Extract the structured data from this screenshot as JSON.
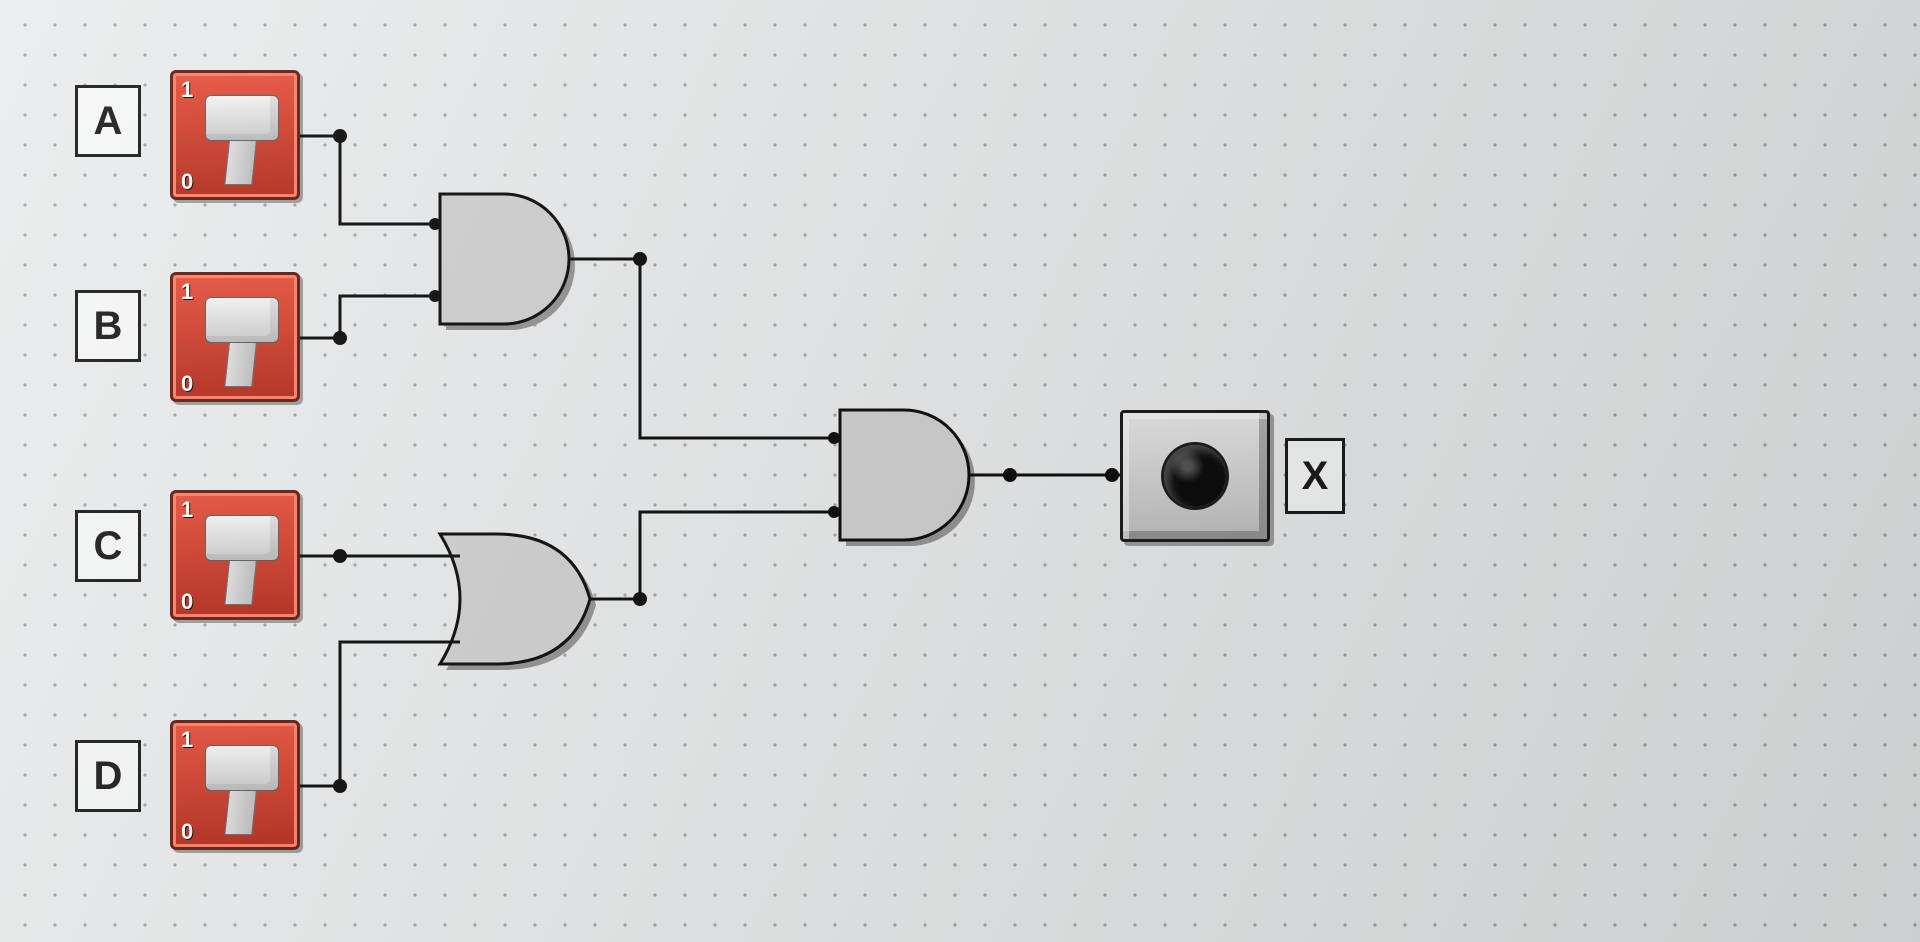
{
  "inputs": [
    {
      "id": "A",
      "label": "A",
      "hi": "1",
      "lo": "0",
      "state": 0
    },
    {
      "id": "B",
      "label": "B",
      "hi": "1",
      "lo": "0",
      "state": 0
    },
    {
      "id": "C",
      "label": "C",
      "hi": "1",
      "lo": "0",
      "state": 0
    },
    {
      "id": "D",
      "label": "D",
      "hi": "1",
      "lo": "0",
      "state": 0
    }
  ],
  "output": {
    "id": "X",
    "label": "X",
    "state": 0
  },
  "gates": [
    {
      "id": "G1",
      "type": "AND",
      "inputs": [
        "A",
        "B"
      ]
    },
    {
      "id": "G2",
      "type": "OR",
      "inputs": [
        "C",
        "D"
      ]
    },
    {
      "id": "G3",
      "type": "AND",
      "inputs": [
        "G1",
        "G2"
      ]
    }
  ],
  "expression": "X = (A AND B) AND (C OR D)",
  "colors": {
    "switch_off": "#d7402b",
    "gate_fill": "#cfcfcf",
    "wire": "#000000",
    "canvas_bg": "#e9ebec",
    "grid_dot": "#9aa0a4"
  }
}
